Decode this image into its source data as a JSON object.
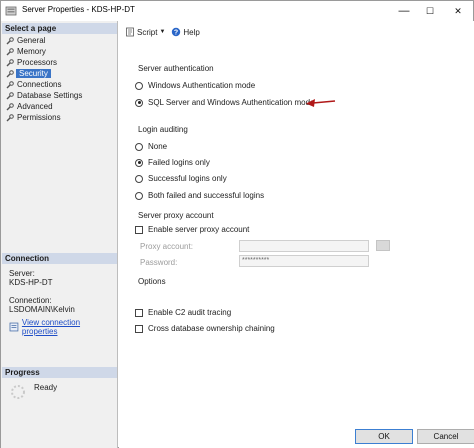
{
  "window": {
    "title": "Server Properties - KDS-HP-DT",
    "minimize": "—",
    "maximize": "☐",
    "close": "✕"
  },
  "left": {
    "select_header": "Select a page",
    "pages": [
      {
        "label": "General",
        "icon": "wrench-icon"
      },
      {
        "label": "Memory",
        "icon": "wrench-icon"
      },
      {
        "label": "Processors",
        "icon": "wrench-icon"
      },
      {
        "label": "Security",
        "icon": "wrench-icon",
        "selected": true
      },
      {
        "label": "Connections",
        "icon": "wrench-icon"
      },
      {
        "label": "Database Settings",
        "icon": "wrench-icon"
      },
      {
        "label": "Advanced",
        "icon": "wrench-icon"
      },
      {
        "label": "Permissions",
        "icon": "wrench-icon"
      }
    ],
    "connection_header": "Connection",
    "server_label": "Server:",
    "server_value": "KDS-HP-DT",
    "connection_label": "Connection:",
    "connection_value": "LSDOMAIN\\Kelvin",
    "view_link": "View connection properties",
    "progress_header": "Progress",
    "progress_status": "Ready"
  },
  "toolbar": {
    "script_label": "Script",
    "help_label": "Help"
  },
  "auth": {
    "heading": "Server authentication",
    "options": [
      "Windows Authentication mode",
      "SQL Server and Windows Authentication mode"
    ],
    "selected": 1
  },
  "audit": {
    "heading": "Login auditing",
    "options": [
      "None",
      "Failed logins only",
      "Successful logins only",
      "Both failed and successful logins"
    ],
    "selected": 1
  },
  "proxy": {
    "heading": "Server proxy account",
    "enable_label": "Enable server proxy account",
    "enabled": false,
    "account_label": "Proxy account:",
    "account_value": "",
    "password_label": "Password:",
    "password_value": "**********"
  },
  "options": {
    "heading": "Options",
    "c2_label": "Enable C2 audit tracing",
    "c2_checked": false,
    "chaining_label": "Cross database ownership chaining",
    "chaining_checked": false
  },
  "buttons": {
    "ok": "OK",
    "cancel": "Cancel"
  },
  "colors": {
    "selected_bg": "#3a74c6",
    "header_bg": "#cfd8e8",
    "link": "#1f4ec7",
    "arrow": "#b01818"
  }
}
